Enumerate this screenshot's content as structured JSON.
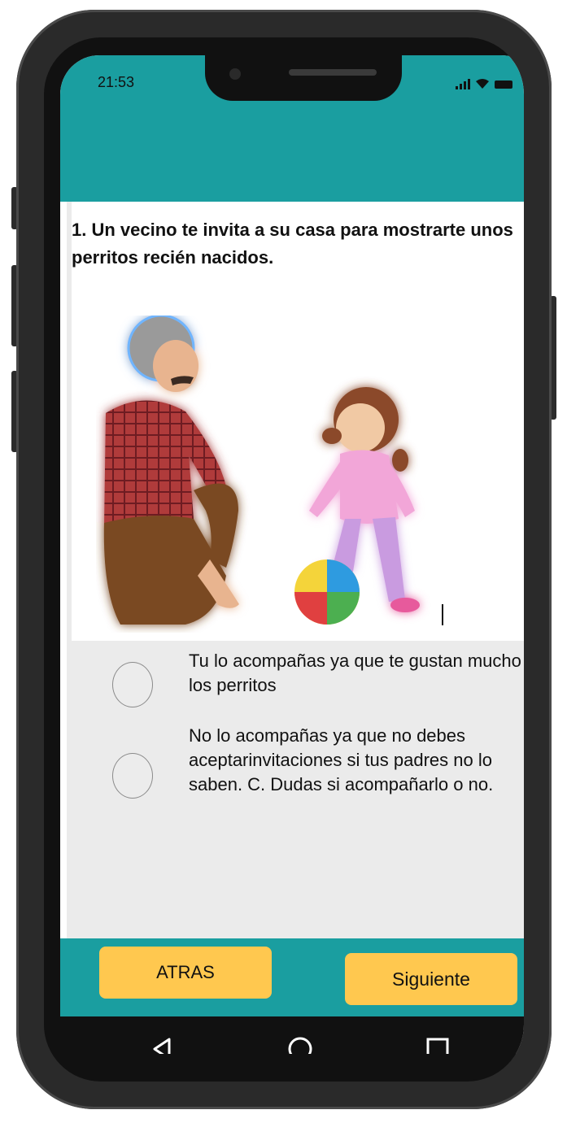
{
  "status_bar": {
    "time": "21:53",
    "icons": [
      "signal-icon",
      "wifi-icon",
      "battery-icon"
    ]
  },
  "question": {
    "title": "1. Un vecino te invita a su casa para mostrarte unos perritos recién nacidos."
  },
  "options": [
    {
      "text": "Tu lo acompañas ya que te gustan mucho los perritos",
      "selected": false
    },
    {
      "text": "No lo acompañas ya que no debes aceptarinvitaciones si tus padres no lo saben. C. Dudas si acompañarlo o no.",
      "selected": false
    }
  ],
  "buttons": {
    "back_label": "ATRAS",
    "next_label": "Siguiente"
  },
  "nav": [
    "back-triangle-icon",
    "home-circle-icon",
    "recents-square-icon"
  ],
  "colors": {
    "teal": "#1a9ea0",
    "button": "#ffc84f",
    "panel": "#ebebeb",
    "frame": "#2a2a2a"
  }
}
